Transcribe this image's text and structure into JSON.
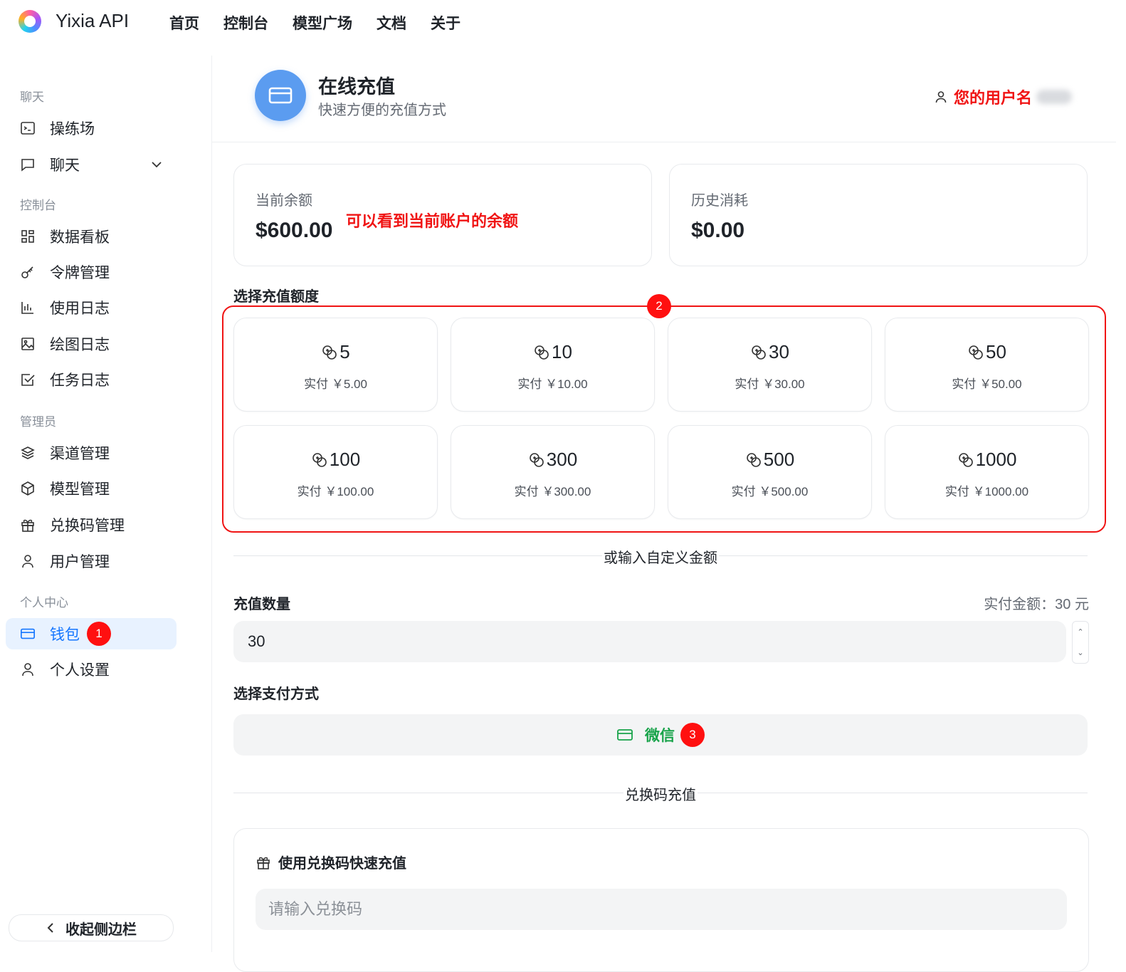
{
  "app": {
    "brand": "Yixia API"
  },
  "nav": [
    "首页",
    "控制台",
    "模型广场",
    "文档",
    "关于"
  ],
  "sidebar": {
    "groups": [
      "聊天",
      "控制台",
      "管理员",
      "个人中心"
    ],
    "items": [
      {
        "label": "操练场",
        "icon": "terminal-icon"
      },
      {
        "label": "聊天",
        "icon": "chat-icon"
      },
      {
        "label": "数据看板",
        "icon": "dashboard-icon"
      },
      {
        "label": "令牌管理",
        "icon": "key-icon"
      },
      {
        "label": "使用日志",
        "icon": "bar-chart-icon"
      },
      {
        "label": "绘图日志",
        "icon": "image-icon"
      },
      {
        "label": "任务日志",
        "icon": "checkbox-icon"
      },
      {
        "label": "渠道管理",
        "icon": "layers-icon"
      },
      {
        "label": "模型管理",
        "icon": "cube-icon"
      },
      {
        "label": "兑换码管理",
        "icon": "gift-icon"
      },
      {
        "label": "用户管理",
        "icon": "user-icon"
      },
      {
        "label": "钱包",
        "icon": "card-icon",
        "active": true,
        "badge": "1"
      },
      {
        "label": "个人设置",
        "icon": "user-icon"
      }
    ],
    "collapse_label": "收起侧边栏"
  },
  "header": {
    "title": "在线充值",
    "subtitle": "快速方便的充值方式",
    "user_label": "您的用户名"
  },
  "stats": {
    "balance_label": "当前余额",
    "balance_value": "$600.00",
    "balance_note": "可以看到当前账户的余额",
    "consumed_label": "历史消耗",
    "consumed_value": "$0.00"
  },
  "amounts": {
    "title": "选择充值额度",
    "badge": "2",
    "options": [
      {
        "amount": "5",
        "pay": "实付 ￥5.00"
      },
      {
        "amount": "10",
        "pay": "实付 ￥10.00"
      },
      {
        "amount": "30",
        "pay": "实付 ￥30.00"
      },
      {
        "amount": "50",
        "pay": "实付 ￥50.00"
      },
      {
        "amount": "100",
        "pay": "实付 ￥100.00"
      },
      {
        "amount": "300",
        "pay": "实付 ￥300.00"
      },
      {
        "amount": "500",
        "pay": "实付 ￥500.00"
      },
      {
        "amount": "1000",
        "pay": "实付 ￥1000.00"
      }
    ]
  },
  "custom": {
    "divider": "或输入自定义金额",
    "qty_label": "充值数量",
    "pay_amount": "实付金额：30 元",
    "qty_value": "30"
  },
  "payment": {
    "title": "选择支付方式",
    "method": "微信",
    "badge": "3",
    "method_color": "#18a34a"
  },
  "redeem": {
    "divider": "兑换码充值",
    "card_title": "使用兑换码快速充值",
    "placeholder": "请输入兑换码"
  },
  "colors": {
    "accent": "#1677ff",
    "annotation": "#f01414",
    "header_icon": "#5b9cf0"
  }
}
